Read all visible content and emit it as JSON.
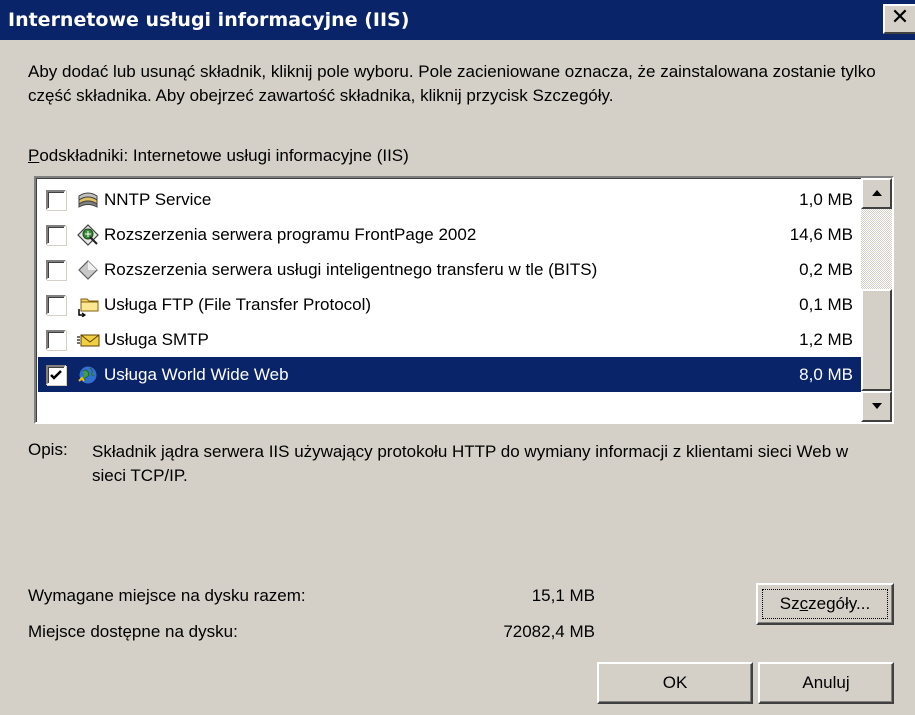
{
  "window": {
    "title": "Internetowe usługi informacyjne (IIS)",
    "close_glyph": "✕"
  },
  "intro_text": "Aby dodać lub usunąć składnik, kliknij pole wyboru. Pole zacieniowane oznacza, że zainstalowana zostanie tylko część składnika. Aby obejrzeć zawartość składnika, kliknij przycisk Szczegóły.",
  "subcomponents": {
    "label_accel": "P",
    "label_rest": "odskładniki: Internetowe usługi informacyjne (IIS)"
  },
  "components": [
    {
      "name": "NNTP Service",
      "size": "1,0 MB",
      "checked": false,
      "icon": "newsgroup-icon"
    },
    {
      "name": "Rozszerzenia serwera programu FrontPage 2002",
      "size": "14,6 MB",
      "checked": false,
      "icon": "frontpage-icon"
    },
    {
      "name": "Rozszerzenia serwera usługi inteligentnego transferu w tle (BITS)",
      "size": "0,2 MB",
      "checked": false,
      "icon": "diamond-icon"
    },
    {
      "name": "Usługa FTP (File Transfer Protocol)",
      "size": "0,1 MB",
      "checked": false,
      "icon": "ftp-folder-icon"
    },
    {
      "name": "Usługa SMTP",
      "size": "1,2 MB",
      "checked": false,
      "icon": "mail-icon"
    },
    {
      "name": "Usługa World Wide Web",
      "size": "8,0 MB",
      "checked": true,
      "selected": true,
      "icon": "globe-icon"
    }
  ],
  "description": {
    "label": "Opis:",
    "text": "Składnik jądra serwera IIS używający protokołu HTTP do wymiany informacji z klientami sieci Web w sieci TCP/IP."
  },
  "disk": {
    "required_label": "Wymagane miejsce na dysku razem:",
    "required_value": "15,1 MB",
    "available_label": "Miejsce dostępne na dysku:",
    "available_value": "72082,4 MB"
  },
  "buttons": {
    "details_pre": "Sz",
    "details_accel": "c",
    "details_post": "zegóły...",
    "ok": "OK",
    "cancel": "Anuluj"
  },
  "colors": {
    "face": "#d4d0c8",
    "titlebar": "#0a246a",
    "selection": "#0a246a"
  }
}
